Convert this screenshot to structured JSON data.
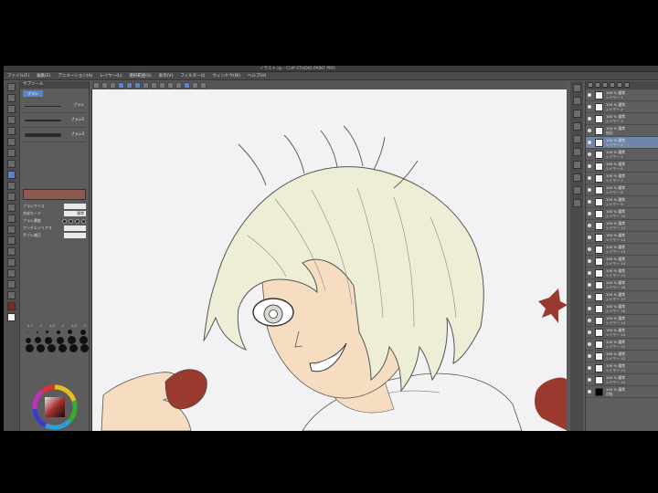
{
  "window": {
    "title": "イラスト.lip - CLIP STUDIO PAINT PRO"
  },
  "menu": [
    "ファイル(F)",
    "編集(E)",
    "アニメーション(A)",
    "レイヤー(L)",
    "選択範囲(S)",
    "表示(V)",
    "フィルター(I)",
    "ウィンドウ(W)",
    "ヘルプ(H)"
  ],
  "subtool": {
    "header": "サブツール",
    "tab": "ブラシ",
    "brushes": [
      "ブラシ",
      "ブラシ2",
      "ブラシ3"
    ],
    "props": [
      {
        "label": "ブラシサイズ",
        "value": ""
      },
      {
        "label": "合成モード",
        "value": "通常"
      },
      {
        "label": "ブラシ濃度",
        "value": ""
      },
      {
        "label": "アンチエイリアス",
        "value": ""
      },
      {
        "label": "手ブレ補正",
        "value": ""
      }
    ]
  },
  "brush_sizes": [
    "0.7",
    "1",
    "1.5",
    "2",
    "2.5",
    "3"
  ],
  "layers": [
    {
      "name": "100 % 通常",
      "sub": "レイヤー 1",
      "sel": false
    },
    {
      "name": "100 % 通常",
      "sub": "レイヤー 2",
      "sel": false
    },
    {
      "name": "100 % 通常",
      "sub": "レイヤー 3",
      "sel": false
    },
    {
      "name": "100 % 通常",
      "sub": "線画",
      "sel": false
    },
    {
      "name": "100 % 通常",
      "sub": "レイヤー 4",
      "sel": true
    },
    {
      "name": "100 % 通常",
      "sub": "レイヤー 5",
      "sel": false
    },
    {
      "name": "100 % 通常",
      "sub": "レイヤー 6",
      "sel": false
    },
    {
      "name": "100 % 通常",
      "sub": "レイヤー 7",
      "sel": false
    },
    {
      "name": "100 % 通常",
      "sub": "レイヤー 8",
      "sel": false
    },
    {
      "name": "100 % 通常",
      "sub": "レイヤー 9",
      "sel": false
    },
    {
      "name": "100 % 通常",
      "sub": "レイヤー 10",
      "sel": false
    },
    {
      "name": "100 % 通常",
      "sub": "レイヤー 11",
      "sel": false
    },
    {
      "name": "100 % 通常",
      "sub": "レイヤー 12",
      "sel": false
    },
    {
      "name": "100 % 通常",
      "sub": "レイヤー 13",
      "sel": false
    },
    {
      "name": "100 % 通常",
      "sub": "レイヤー 14",
      "sel": false
    },
    {
      "name": "100 % 通常",
      "sub": "レイヤー 15",
      "sel": false
    },
    {
      "name": "100 % 通常",
      "sub": "レイヤー 16",
      "sel": false
    },
    {
      "name": "100 % 通常",
      "sub": "レイヤー 17",
      "sel": false
    },
    {
      "name": "100 % 通常",
      "sub": "レイヤー 18",
      "sel": false
    },
    {
      "name": "100 % 通常",
      "sub": "レイヤー 19",
      "sel": false
    },
    {
      "name": "100 % 通常",
      "sub": "レイヤー 20",
      "sel": false
    },
    {
      "name": "100 % 通常",
      "sub": "レイヤー 21",
      "sel": false
    },
    {
      "name": "100 % 通常",
      "sub": "レイヤー 22",
      "sel": false
    },
    {
      "name": "100 % 通常",
      "sub": "レイヤー 23",
      "sel": false
    },
    {
      "name": "100 % 通常",
      "sub": "レイヤー 24",
      "sel": false
    },
    {
      "name": "100 % 通常",
      "sub": "用紙",
      "sel": false
    }
  ],
  "colors": {
    "hair": "#eeeed6",
    "skin": "#f6dcc0",
    "strawberry": "#9a3a2e",
    "accent_blue": "#5a86c9"
  }
}
